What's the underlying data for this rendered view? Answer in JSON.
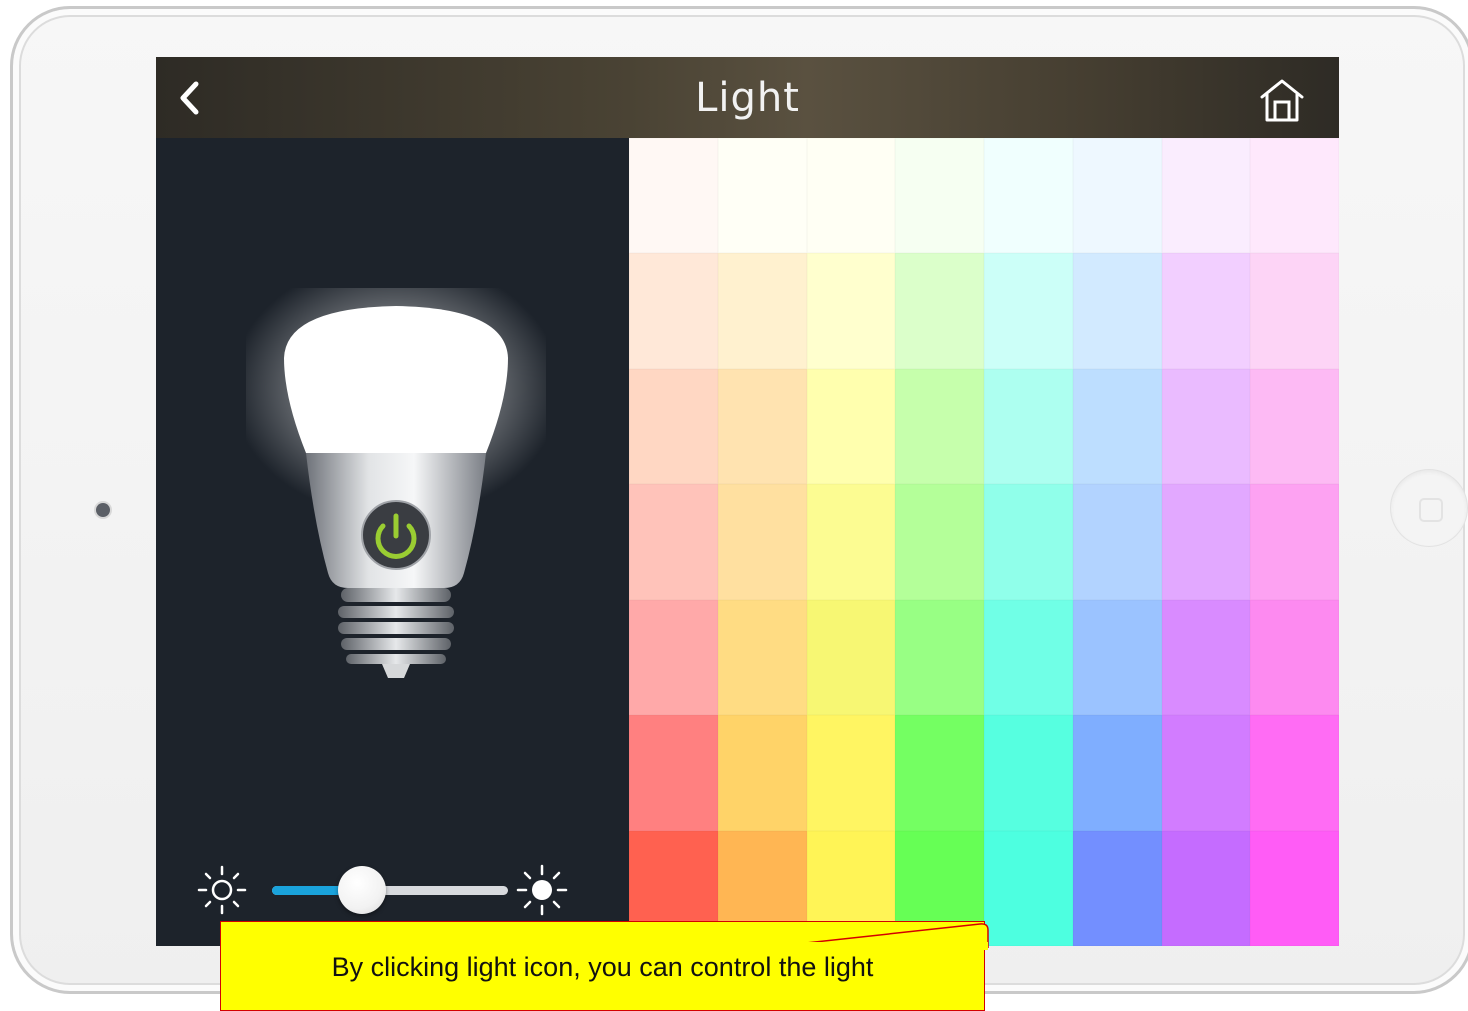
{
  "app": {
    "title": "Light"
  },
  "header": {
    "back_icon": "chevron-left-icon",
    "home_icon": "home-icon"
  },
  "bulb": {
    "state": "on",
    "power_icon": "power-icon",
    "power_color": "#9ACD32"
  },
  "brightness": {
    "value_fraction": 0.38,
    "min_icon": "sun-dim-icon",
    "max_icon": "sun-bright-icon",
    "accent": "#1AA3DC"
  },
  "palette": {
    "rows": [
      [
        "#FFF8F4",
        "#FFFFF6",
        "#FFFFF4",
        "#F6FFF2",
        "#F0FFFE",
        "#EEF8FF",
        "#FAEDFE",
        "#FEE8FC"
      ],
      [
        "#FFE8D8",
        "#FFF1CF",
        "#FFFFCE",
        "#DBFFCA",
        "#CCFFF8",
        "#D2EAFF",
        "#F2CFFF",
        "#FDD4F6"
      ],
      [
        "#FFD7C3",
        "#FFE3B0",
        "#FFFFAE",
        "#C6FFAC",
        "#ADFFF0",
        "#BDDEFF",
        "#EABBFF",
        "#FDBAF4"
      ],
      [
        "#FFC3BA",
        "#FFE0A0",
        "#FCFC92",
        "#B4FF99",
        "#90FFEA",
        "#B2D3FF",
        "#E2A8FF",
        "#FDA2F2"
      ],
      [
        "#FFA9A9",
        "#FFDC83",
        "#F7F773",
        "#98FF84",
        "#70FFE6",
        "#9BC3FF",
        "#D98BFF",
        "#FD8AF0"
      ],
      [
        "#FF8080",
        "#FFD368",
        "#FFF562",
        "#74FF62",
        "#56FFE0",
        "#7FAEFF",
        "#D27CFF",
        "#FF6CF4"
      ],
      [
        "#FF6150",
        "#FFB653",
        "#FFF456",
        "#66FF55",
        "#4DFFE0",
        "#738FFF",
        "#C56CFF",
        "#FF5CF6"
      ]
    ]
  },
  "callout": {
    "text": "By clicking light icon, you can control the light",
    "background": "#FFFF00",
    "border": "#D30000"
  }
}
